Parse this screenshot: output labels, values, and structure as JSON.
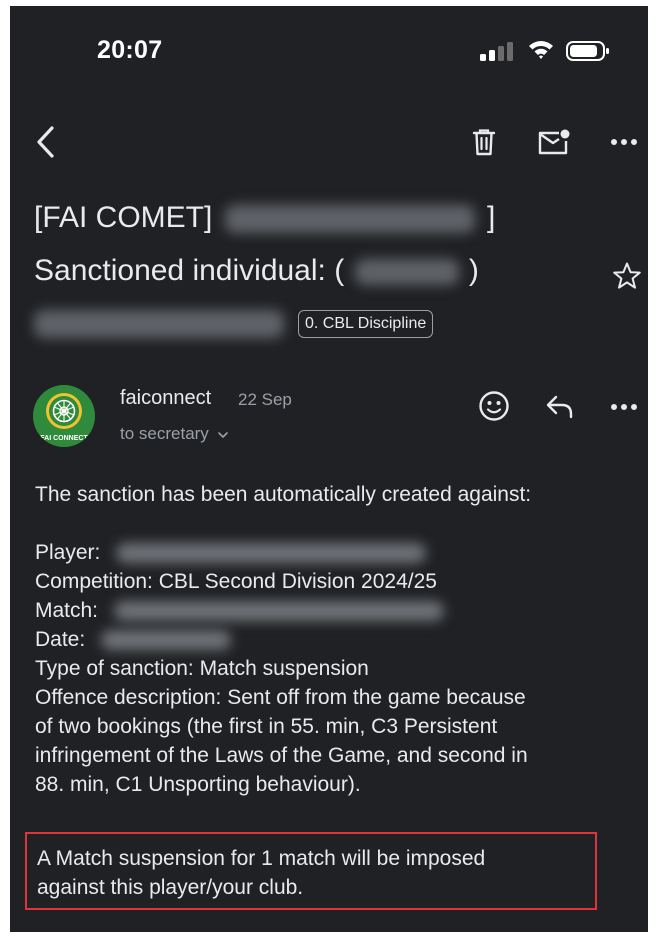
{
  "status_bar": {
    "time": "20:07"
  },
  "toolbar": {
    "back_icon": "chevron-left-icon",
    "delete_icon": "trash-icon",
    "mark_unread_icon": "mail-unread-icon",
    "more_icon": "more-horizontal-icon"
  },
  "subject": {
    "line1_prefix": "[FAI COMET]",
    "line1_suffix": "]",
    "line2_prefix": "Sanctioned individual: (",
    "line2_suffix": ")",
    "label": "0. CBL Discipline",
    "star_icon": "star-outline-icon"
  },
  "message": {
    "sender": "faiconnect",
    "date": "22 Sep",
    "recipient": "to secretary",
    "avatar_text": "FAI CONNECT",
    "body": {
      "intro": "The sanction has been automatically created against:",
      "player_label": "Player:",
      "competition": "Competition: CBL Second Division 2024/25",
      "match_label": "Match:",
      "date_label": "Date:",
      "type": "Type of sanction: Match suspension",
      "offence_1": "Offence description: Sent off from the game because",
      "offence_2": "of two bookings (the first in 55. min, C3 Persistent",
      "offence_3": "infringement of the Laws of the Game, and second in",
      "offence_4": "88. min, C1 Unsporting behaviour).",
      "highlight_1": "A Match suspension for 1 match will be imposed",
      "highlight_2": "against this player/your club."
    }
  },
  "colors": {
    "background": "#202124",
    "text": "#e8eaed",
    "secondary_text": "#9aa0a6",
    "highlight_border": "#e0343b",
    "avatar_green": "#2f8a3b"
  }
}
